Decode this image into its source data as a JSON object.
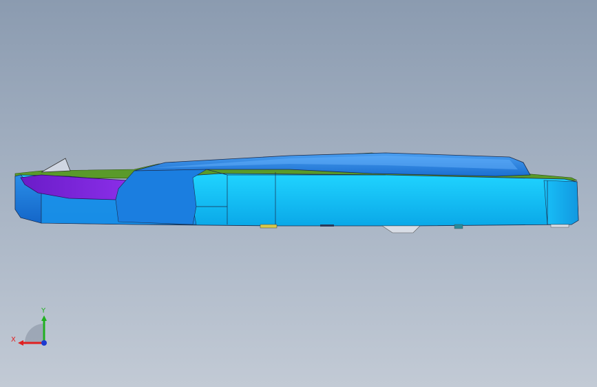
{
  "viewport": {
    "background_top": "#8b9bb0",
    "background_bottom": "#c2cad5"
  },
  "model": {
    "main_color": "#14c4f8",
    "dark_blue": "#1a7ad8",
    "purple": "#7a22d8",
    "green": "#5a9a2a"
  },
  "triad": {
    "x_label": "X",
    "y_label": "Y",
    "x_color": "#e02020",
    "y_color": "#20b020",
    "z_color": "#1d3ad0"
  }
}
